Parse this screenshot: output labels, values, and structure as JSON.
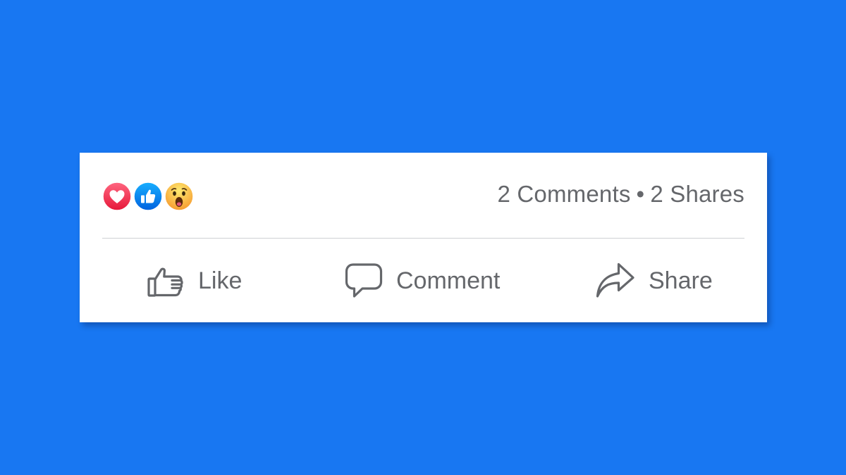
{
  "colors": {
    "background": "#1877F2",
    "card": "#FFFFFF",
    "text": "#65676B",
    "divider": "#CED0D4",
    "love": "#F33E58",
    "like": "#1877F2",
    "wow": "#F7B125"
  },
  "reactions": [
    {
      "type": "love",
      "icon": "heart-icon"
    },
    {
      "type": "like",
      "icon": "thumbs-up-icon"
    },
    {
      "type": "wow",
      "icon": "wow-face-icon"
    }
  ],
  "stats": {
    "comments": "2 Comments",
    "separator": "•",
    "shares": "2 Shares"
  },
  "actions": {
    "like": {
      "label": "Like",
      "icon": "thumbs-up-outline-icon"
    },
    "comment": {
      "label": "Comment",
      "icon": "speech-bubble-icon"
    },
    "share": {
      "label": "Share",
      "icon": "share-arrow-icon"
    }
  }
}
